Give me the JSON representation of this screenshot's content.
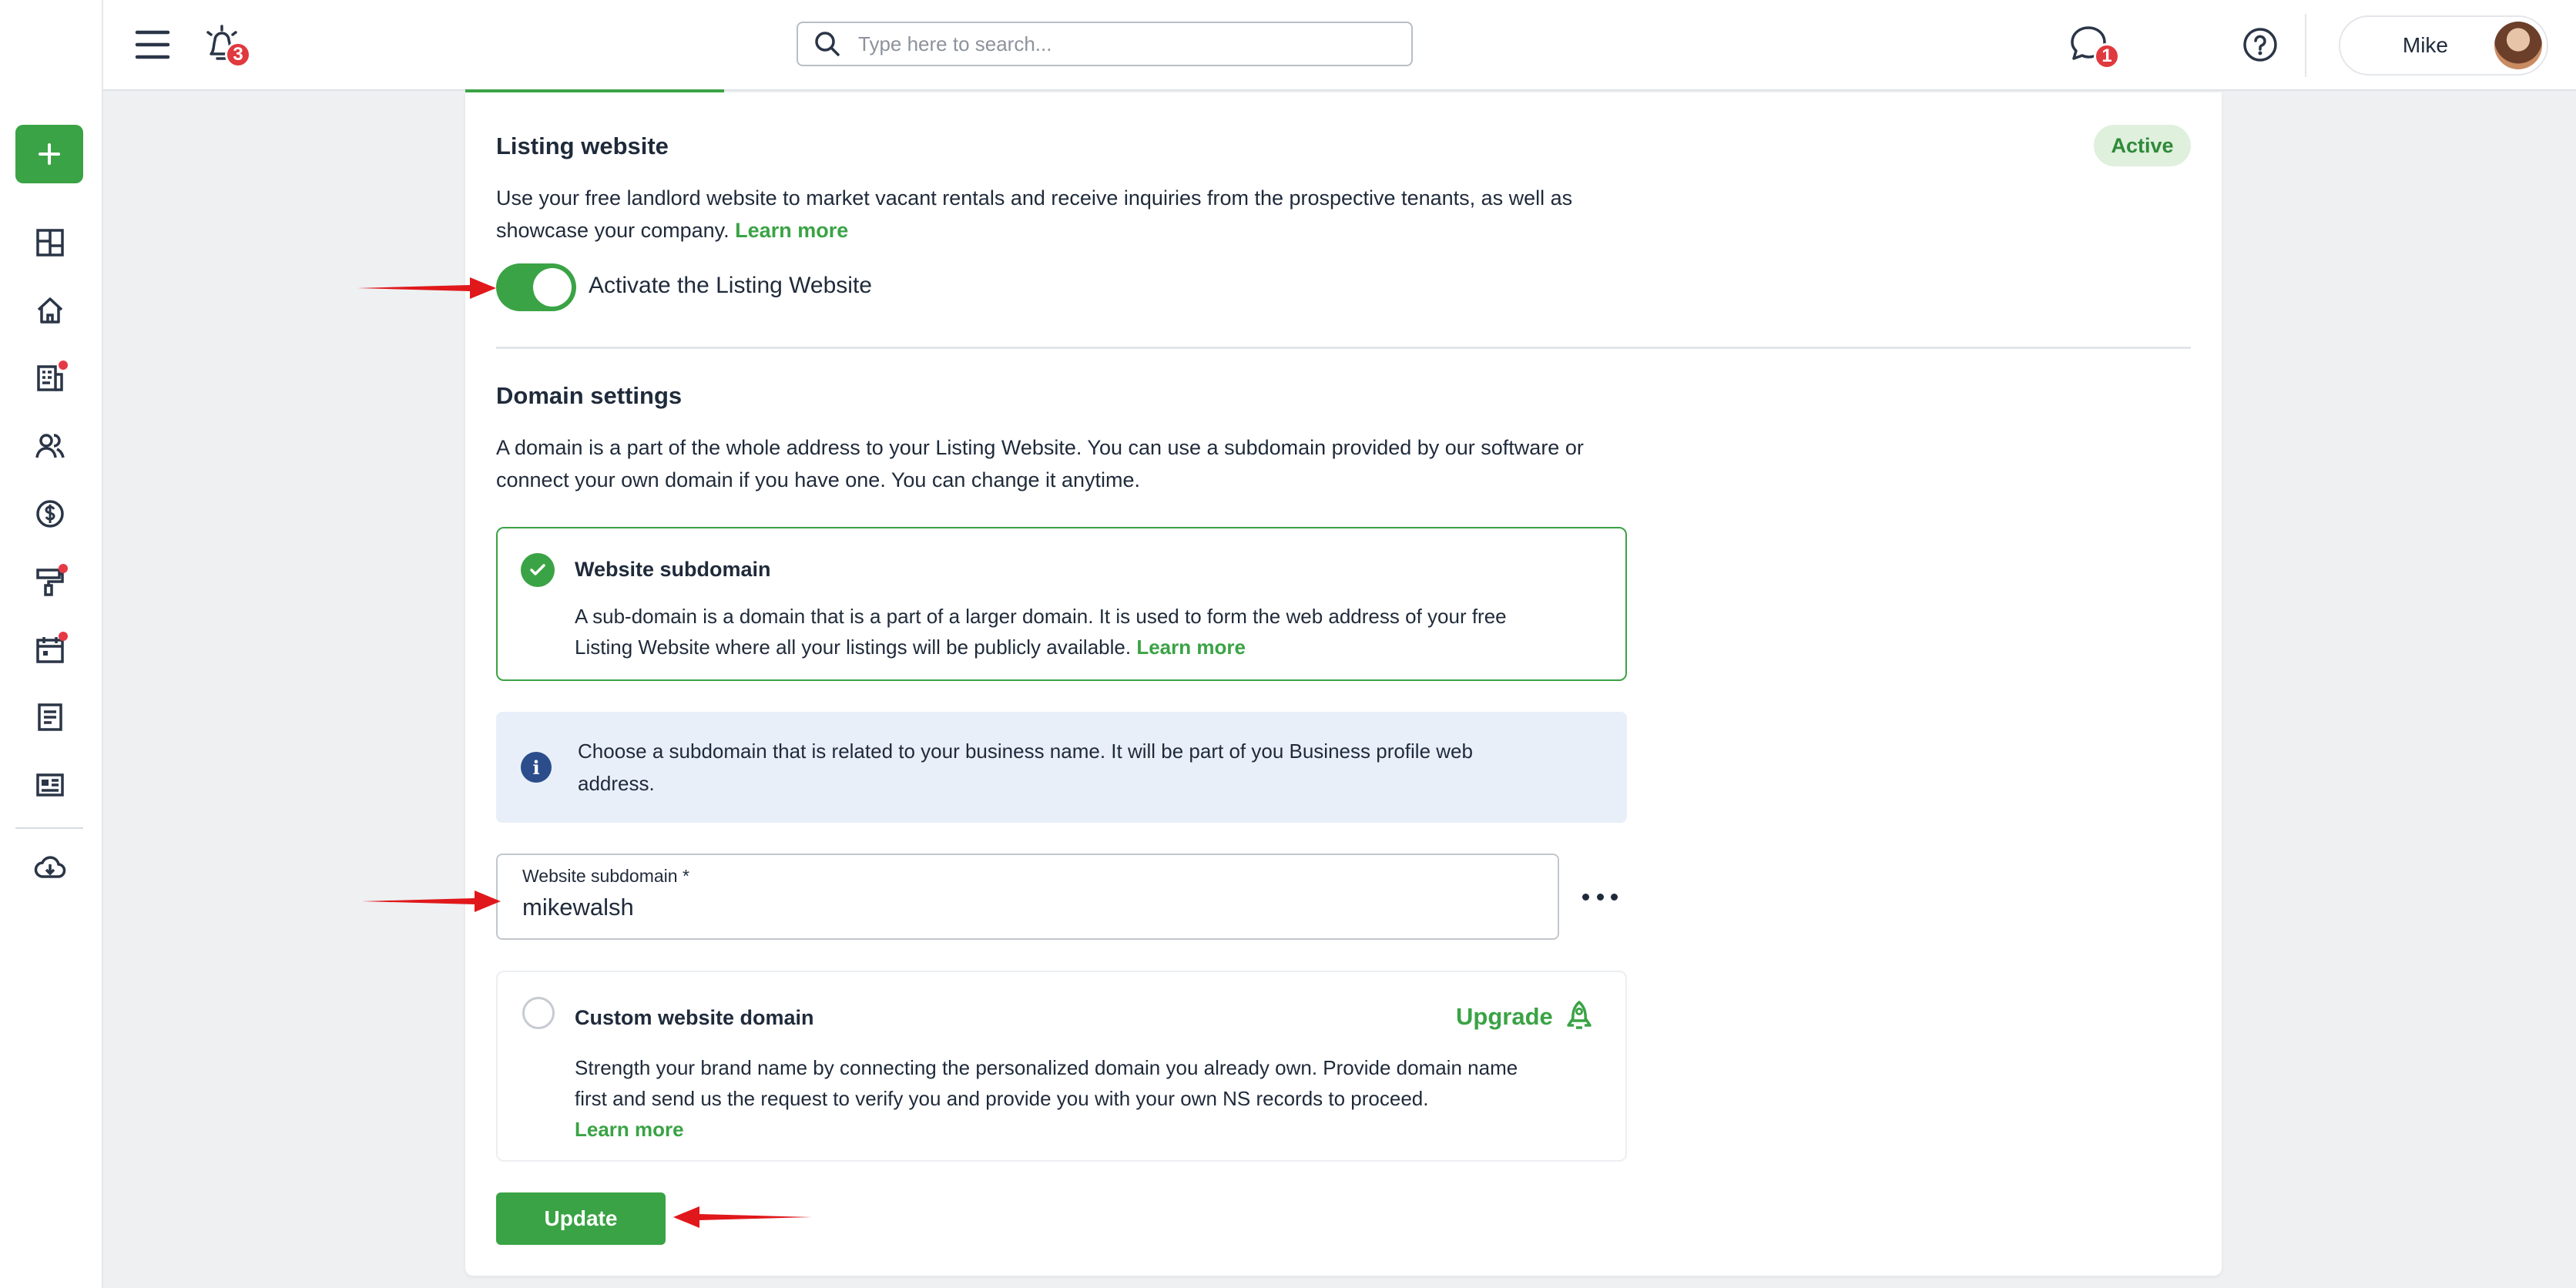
{
  "header": {
    "notifications_count": "3",
    "search_placeholder": "Type here to search...",
    "messages_count": "1",
    "user_name": "Mike"
  },
  "listing": {
    "title": "Listing website",
    "status": "Active",
    "description": "Use your free landlord website to market vacant rentals and receive inquiries from the prospective tenants, as well as showcase your company.",
    "learn_more": "Learn more",
    "toggle_label": "Activate the Listing Website",
    "toggle_on": true
  },
  "domain": {
    "title": "Domain settings",
    "description_line1": "A domain is a part of the whole address to your Listing Website. You can use a subdomain provided by our software or",
    "description_line2": "connect your own domain if you have one. You can change it anytime.",
    "subdomain_option": {
      "title": "Website subdomain",
      "line1": "A sub-domain is a domain that is a part of a larger domain. It is used to form the web address of your free",
      "line2": "Listing Website where all your listings will be publicly available.",
      "learn_more": "Learn more",
      "selected": true
    },
    "info_line1": "Choose a subdomain that is related to your business name. It will be part of you Business profile web",
    "info_line2": "address.",
    "field_label": "Website subdomain *",
    "field_value": "mikewalsh",
    "custom_option": {
      "title": "Custom website domain",
      "upgrade": "Upgrade",
      "line1": "Strength your brand name by connecting the personalized domain you already own. Provide domain name",
      "line2": "first and send us the request to verify you and provide you with your own NS records to proceed.",
      "learn_more": "Learn more",
      "selected": false
    },
    "update_label": "Update"
  },
  "colors": {
    "accent": "#3aa345",
    "annotation_arrow": "#e0181b",
    "info_bg": "#e8eff9"
  }
}
